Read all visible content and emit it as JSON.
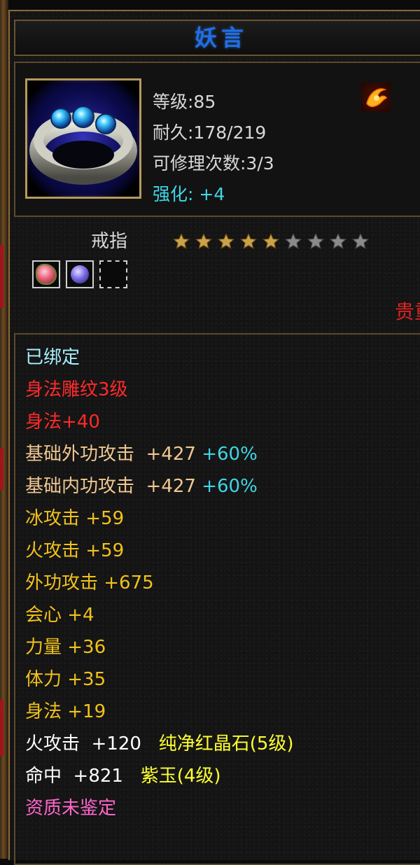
{
  "item": {
    "name": "妖言",
    "level": "等级:85",
    "durability": "耐久:178/219",
    "repairs": "可修理次数:3/3",
    "enhance": "强化: +4",
    "type": "戒指",
    "stars_total": 9,
    "stars_filled": 5,
    "bind_tag": "贵重"
  },
  "sockets": [
    {
      "state": "filled",
      "gem": "red-gem-icon",
      "color": "#e6607a"
    },
    {
      "state": "filled",
      "gem": "purple-gem-icon",
      "color": "#7a6ae6"
    },
    {
      "state": "empty"
    }
  ],
  "colors": {
    "title": "#1f6fe8",
    "bound": "#a8f0ff",
    "engrave": "#ff2a2a",
    "base": "#f0c890",
    "cyan": "#3fd6e6",
    "yellow": "#f2c21a",
    "gem_text": "#ffff33",
    "white": "#ffffff",
    "pink": "#ff66cc"
  },
  "attributes": {
    "bound": "已绑定",
    "engrave_title": "身法雕纹3级",
    "engrave_bonus": "身法+40",
    "base_ext": {
      "label": "基础外功攻击  +427",
      "pct": "+60%"
    },
    "base_int": {
      "label": "基础内功攻击  +427",
      "pct": "+60%"
    },
    "ice_atk": "冰攻击  +59",
    "fire_atk": "火攻击  +59",
    "ext_atk": "外功攻击  +675",
    "crit": "会心  +4",
    "strength": "力量  +36",
    "stamina": "体力  +35",
    "agility": "身法  +19",
    "gem1": {
      "label": "火攻击  +120  ",
      "gem": "纯净红晶石(5级)"
    },
    "gem2": {
      "label": "命中  +821  ",
      "gem": "紫玉(4级)"
    },
    "quality": "资质未鉴定"
  }
}
